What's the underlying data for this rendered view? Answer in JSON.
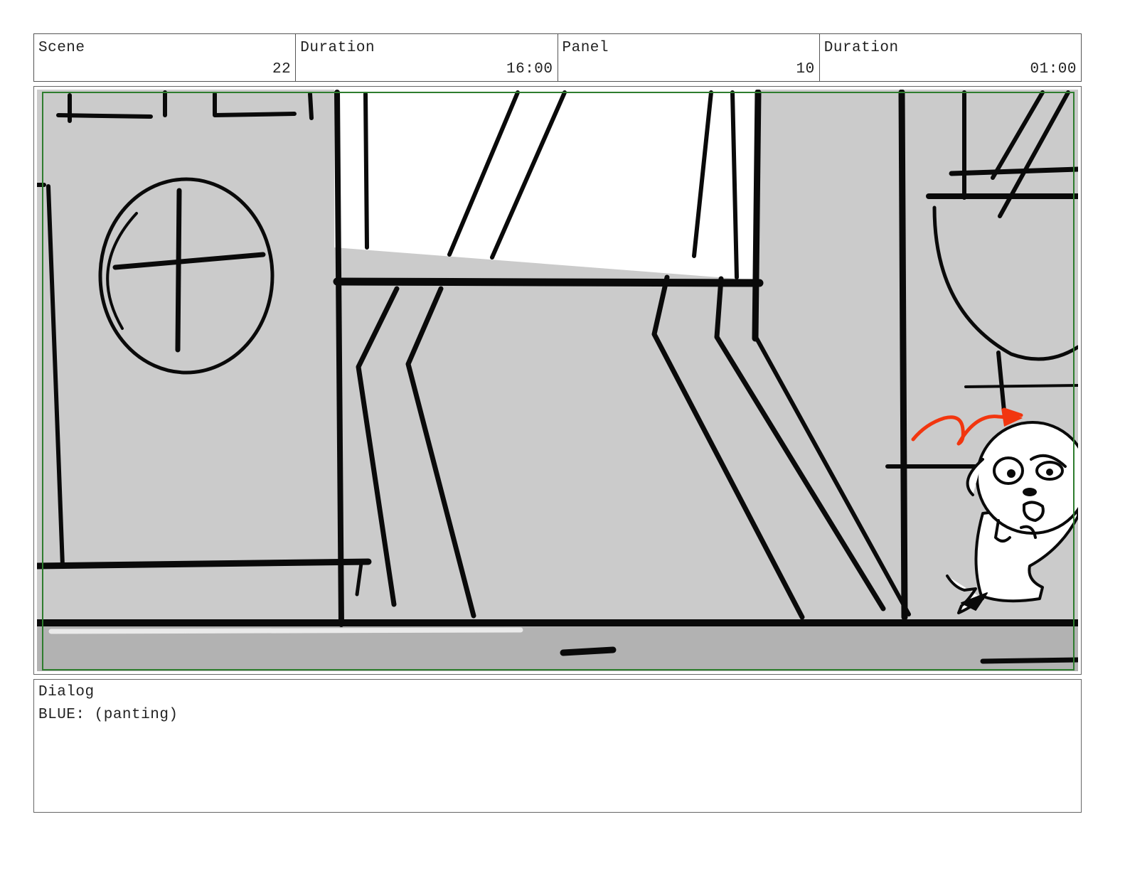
{
  "header": {
    "scene": {
      "label": "Scene",
      "value": "22"
    },
    "scene_duration": {
      "label": "Duration",
      "value": "16:00"
    },
    "panel": {
      "label": "Panel",
      "value": "10"
    },
    "panel_duration": {
      "label": "Duration",
      "value": "01:00"
    }
  },
  "dialog": {
    "label": "Dialog",
    "text": "BLUE: (panting)"
  },
  "colors": {
    "wall": "#cbcbcb",
    "floor": "#b2b2b2",
    "ink": "#0a0a0a",
    "safe_frame": "#2e7d2e",
    "accent_scribble": "#f2360f"
  }
}
